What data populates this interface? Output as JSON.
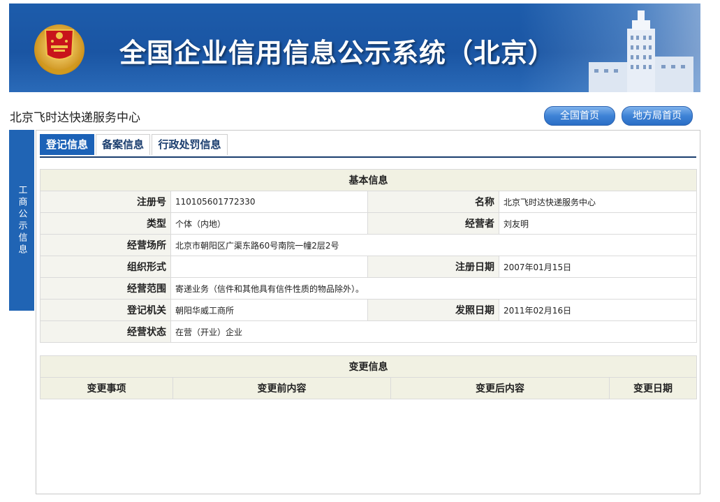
{
  "banner": {
    "title": "全国企业信用信息公示系统（北京）"
  },
  "header": {
    "company_name": "北京飞时达快递服务中心",
    "buttons": {
      "national_home": "全国首页",
      "local_home": "地方局首页"
    }
  },
  "side_tab": {
    "label": "工商公示信息"
  },
  "tabs": [
    {
      "label": "登记信息",
      "active": true
    },
    {
      "label": "备案信息",
      "active": false
    },
    {
      "label": "行政处罚信息",
      "active": false
    }
  ],
  "basic_info": {
    "title": "基本信息",
    "reg_no_label": "注册号",
    "reg_no": "110105601772330",
    "name_label": "名称",
    "name": "北京飞时达快递服务中心",
    "type_label": "类型",
    "type": "个体（内地）",
    "operator_label": "经营者",
    "operator": "刘友明",
    "address_label": "经营场所",
    "address": "北京市朝阳区广渠东路60号南院一幢2层2号",
    "org_form_label": "组织形式",
    "org_form": "",
    "reg_date_label": "注册日期",
    "reg_date": "2007年01月15日",
    "scope_label": "经营范围",
    "scope": "寄递业务（信件和其他具有信件性质的物品除外）。",
    "authority_label": "登记机关",
    "authority": "朝阳华威工商所",
    "issue_date_label": "发照日期",
    "issue_date": "2011年02月16日",
    "status_label": "经营状态",
    "status": "在营（开业）企业"
  },
  "change_info": {
    "title": "变更信息",
    "columns": [
      "变更事项",
      "变更前内容",
      "变更后内容",
      "变更日期"
    ]
  },
  "colors": {
    "banner_blue": "#1d5cab",
    "tab_active": "#1c62b7",
    "side_tab": "#2064b4",
    "label_bg": "#f4f4ee"
  }
}
